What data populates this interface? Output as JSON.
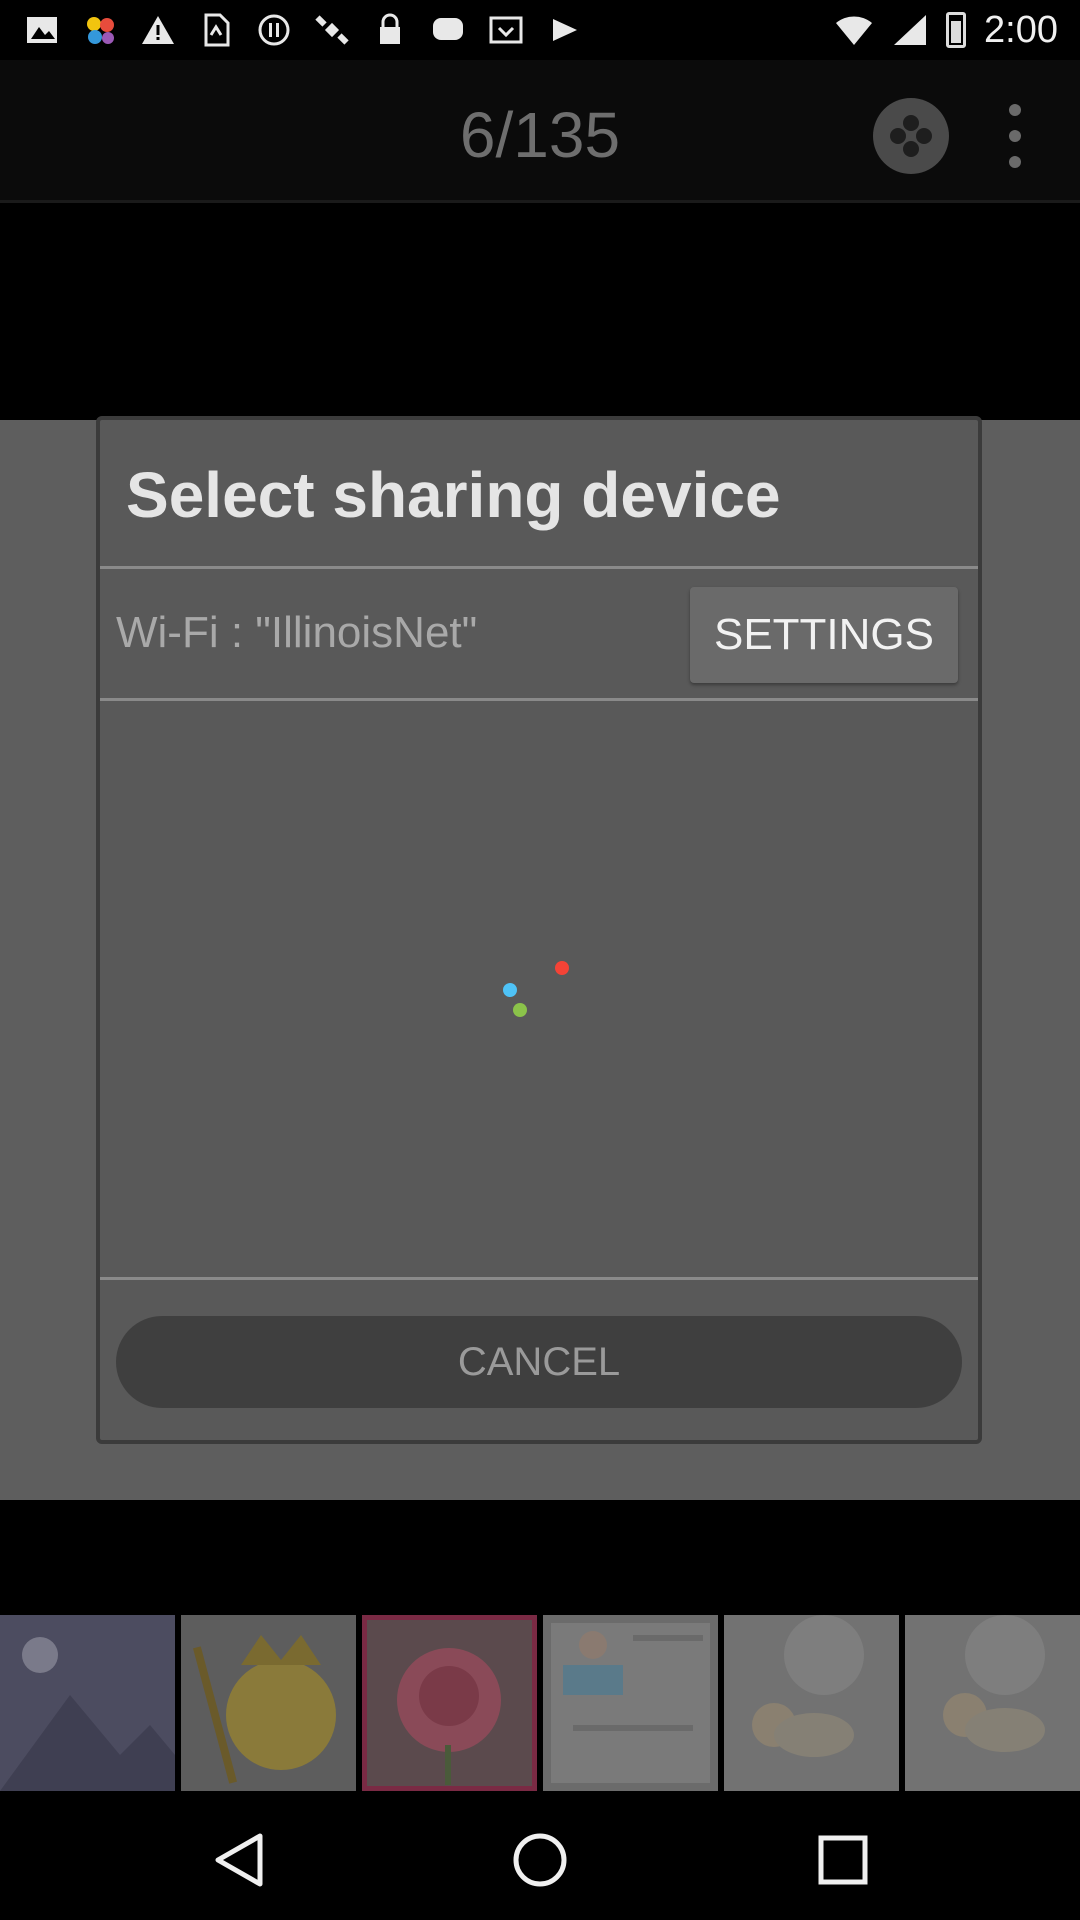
{
  "status_bar": {
    "time": "2:00",
    "icons": [
      "image-icon",
      "pinwheel-icon",
      "warning-icon",
      "sim-icon",
      "block-icon",
      "satellite-icon",
      "lock-icon",
      "message-icon",
      "inbox-icon",
      "briefcase-icon"
    ]
  },
  "app_bar": {
    "counter": "6/135",
    "share_icon": "share-icon",
    "menu_icon": "more-vert-icon"
  },
  "dialog": {
    "title": "Select sharing device",
    "wifi_label": "Wi-Fi : \"IllinoisNet\"",
    "settings_label": "SETTINGS",
    "cancel_label": "CANCEL",
    "spinner_colors": [
      "#4fc3f7",
      "#8bc34a",
      "#f44336"
    ]
  },
  "thumbnails": [
    "placeholder",
    "crown-emoji",
    "rose",
    "baby-poster",
    "baby-massage-1",
    "baby-massage-2"
  ],
  "nav_bar": {
    "back_icon": "back-icon",
    "home_icon": "home-icon",
    "recents_icon": "recents-icon"
  }
}
